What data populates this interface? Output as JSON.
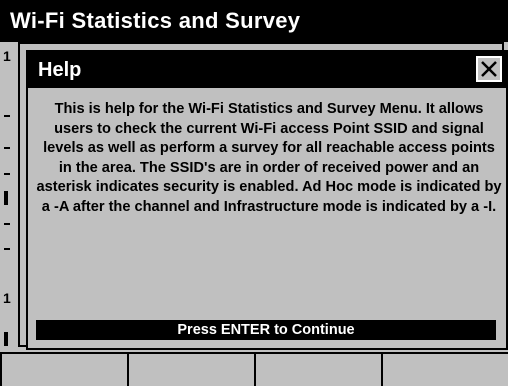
{
  "window": {
    "title": "Wi-Fi Statistics and Survey"
  },
  "background": {
    "row_marker_1": "1",
    "row_marker_2": "1"
  },
  "dialog": {
    "title": "Help",
    "close_icon": "close-x-icon",
    "body": "This is help for the Wi-Fi Statistics and Survey Menu. It allows users to check the current Wi-Fi access Point SSID and signal levels as well as perform a survey for all reachable access points in the area. The SSID's are in order of received power and an asterisk indicates security is enabled. Ad Hoc mode is indicated by a -A after the channel and Infrastructure mode is indicated by a -I.",
    "continue_label": "Press ENTER to Continue"
  },
  "softkeys": [
    "",
    "",
    "",
    ""
  ]
}
